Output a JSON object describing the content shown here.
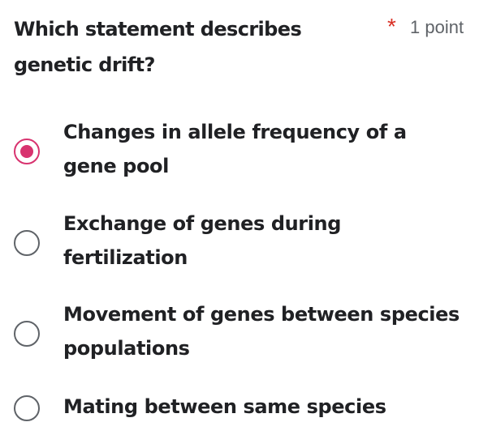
{
  "question": {
    "title": "Which statement describes genetic drift?",
    "required_marker": "*",
    "points": "1 point"
  },
  "options": [
    {
      "label": "Changes in allele frequency of a gene pool",
      "selected": true
    },
    {
      "label": "Exchange of genes during fertilization",
      "selected": false
    },
    {
      "label": "Movement of genes between species populations",
      "selected": false
    },
    {
      "label": "Mating between same species",
      "selected": false
    }
  ],
  "colors": {
    "accent": "#d8336f",
    "required": "#d93025",
    "unselected_radio": "#5f6368",
    "text": "#202124",
    "muted": "#5f6368"
  },
  "icons": {
    "selected": "radio-selected-icon",
    "unselected": "radio-unselected-icon"
  }
}
